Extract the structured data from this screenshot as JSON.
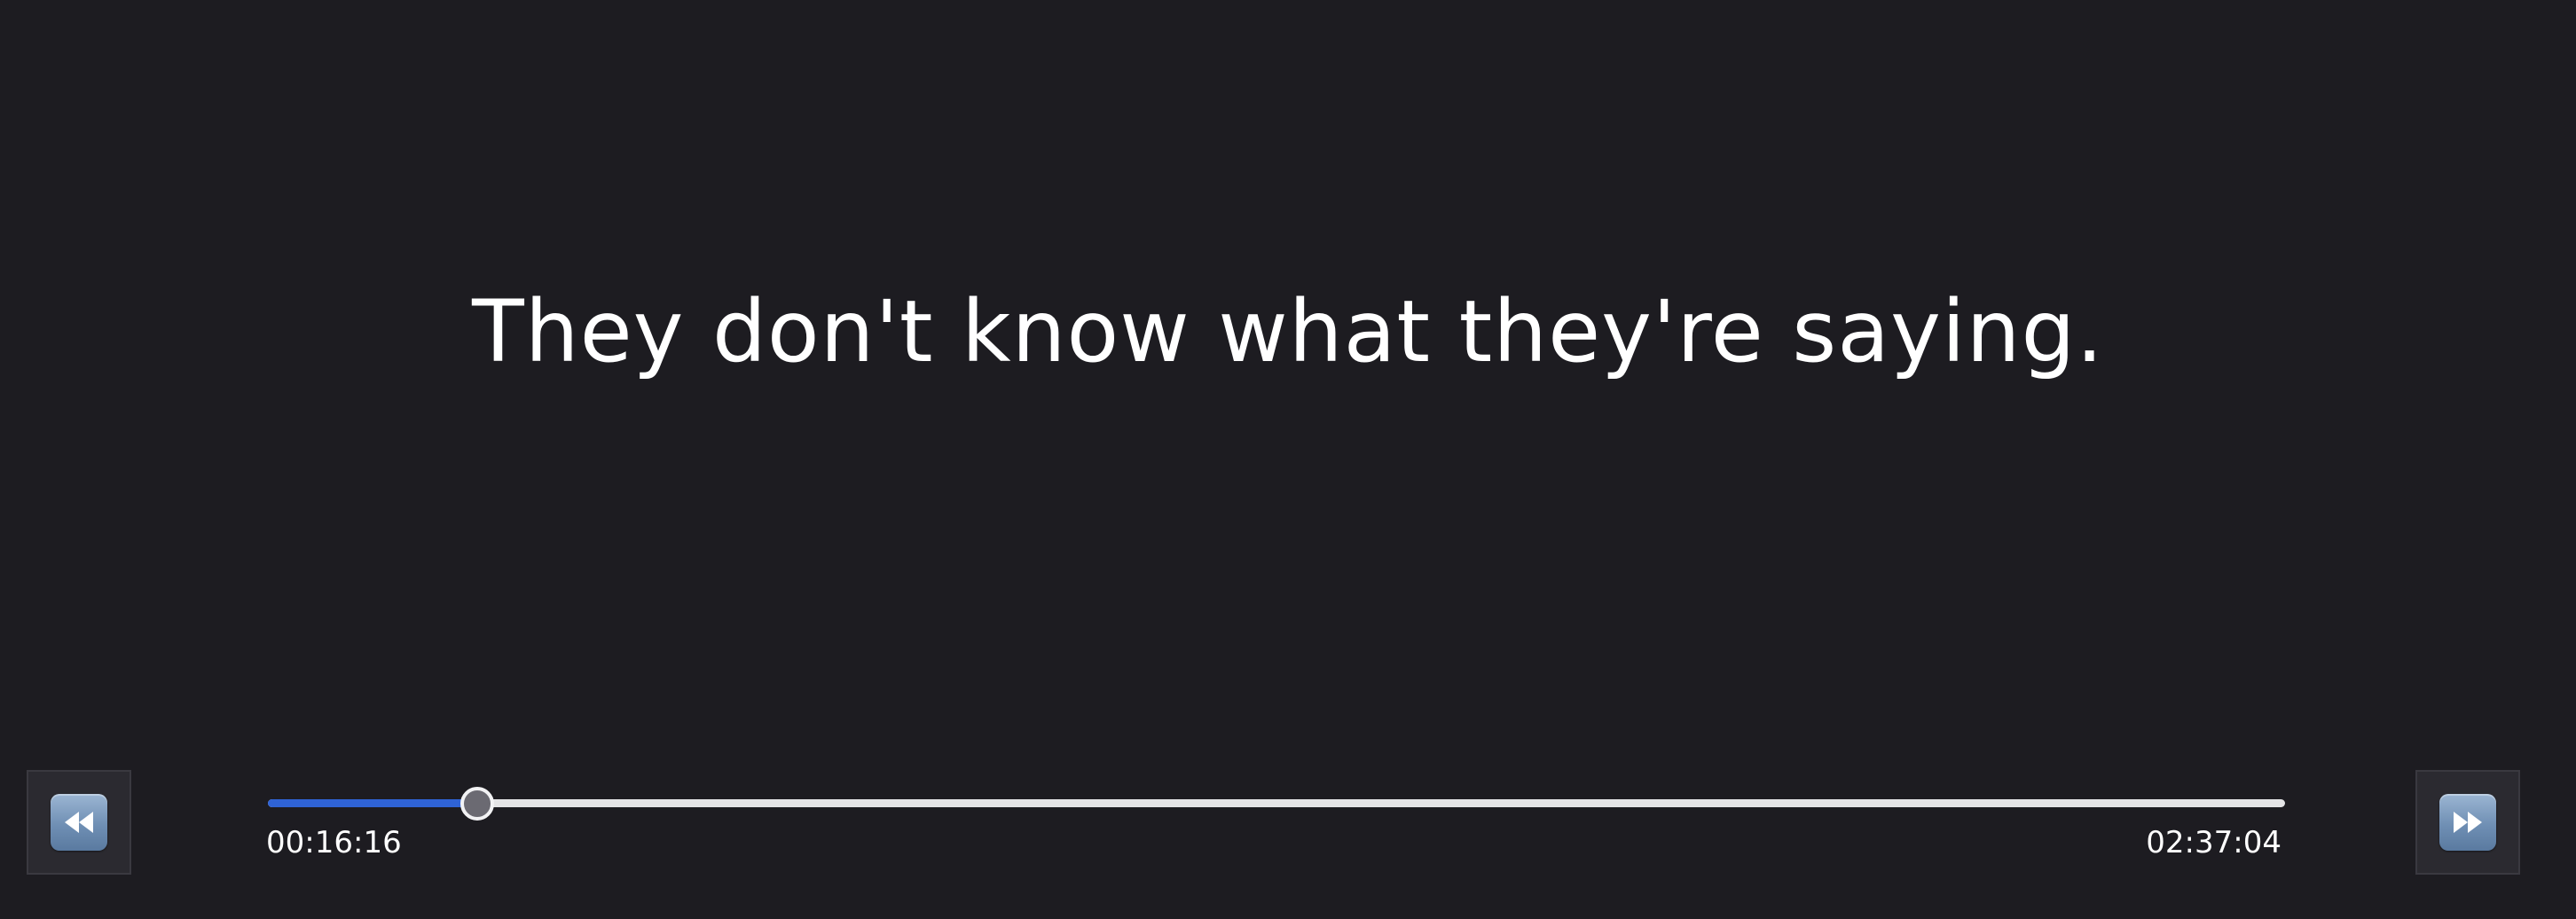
{
  "subtitle": {
    "text": "They don't know what they're saying."
  },
  "controls": {
    "rewind_icon": "rewind-icon",
    "fast_forward_icon": "fast-forward-icon"
  },
  "playback": {
    "current_time": "00:16:16",
    "total_time": "02:37:04",
    "progress": 0.1037
  },
  "colors": {
    "background": "#1d1c21",
    "progress_fill": "#2f63d6",
    "track": "#e4e4e6",
    "text": "#ffffff"
  }
}
